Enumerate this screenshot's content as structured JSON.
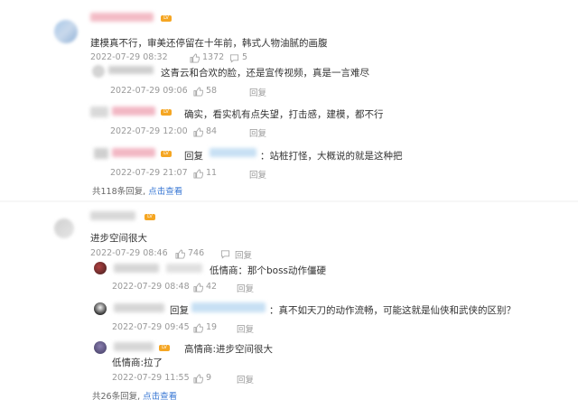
{
  "thread1": {
    "root": {
      "content": "建模真不行，审美还停留在十年前，韩式人物油腻的画腹",
      "time": "2022-07-29 08:32",
      "likes": "1372",
      "comments": "5"
    },
    "replies": [
      {
        "content": "这青云和合欢的脸，还是宣传视频，真是一言难尽",
        "time": "2022-07-29 09:06",
        "likes": "58",
        "reply_label": "回复"
      },
      {
        "content": "确实，看实机有点失望，打击感，建模，都不行",
        "time": "2022-07-29 12:00",
        "likes": "84",
        "reply_label": "回复"
      },
      {
        "prefix": "回复",
        "content": "：站桩打怪，大概说的就是这种把",
        "time": "2022-07-29 21:07",
        "likes": "11",
        "reply_label": "回复"
      }
    ],
    "footer_count": "共118条回复,",
    "footer_link": "点击查看"
  },
  "thread2": {
    "root": {
      "content": "进步空间很大",
      "time": "2022-07-29 08:46",
      "likes": "746",
      "reply_label": "回复"
    },
    "replies": [
      {
        "content": "低情商：那个boss动作僵硬",
        "time": "2022-07-29 08:48",
        "likes": "42",
        "reply_label": "回复"
      },
      {
        "prefix": "回复",
        "content": "：真不如天刀的动作流畅，可能这就是仙侠和武侠的区别？",
        "time": "2022-07-29 09:45",
        "likes": "19",
        "reply_label": "回复"
      },
      {
        "content": "高情商:进步空间很大",
        "content2": "低情商:拉了",
        "time": "2022-07-29 11:55",
        "likes": "9",
        "reply_label": "回复"
      }
    ],
    "footer_count": "共26条回复,",
    "footer_link": "点击查看"
  },
  "icons": {
    "like": "thumb-up-icon",
    "comment": "comment-icon",
    "level": "level-badge-icon"
  },
  "colors": {
    "link": "#3a78d4",
    "meta": "#999999",
    "level_badge": "#f5a623"
  }
}
